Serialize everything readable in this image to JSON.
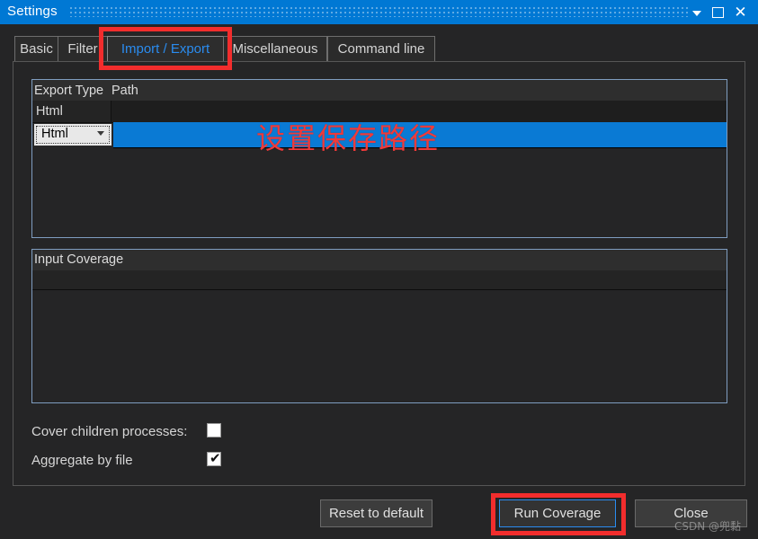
{
  "window": {
    "title": "Settings",
    "controls": {
      "minimize_icon": "chevron-down-icon",
      "maximize_icon": "maximize-square-icon",
      "close_icon": "close-x-icon",
      "close_glyph": "✕"
    },
    "accent_color": "#0078d4"
  },
  "tabs": [
    {
      "label": "Basic",
      "selected": false
    },
    {
      "label": "Filter",
      "selected": false
    },
    {
      "label": "Import / Export",
      "selected": true
    },
    {
      "label": "Miscellaneous",
      "selected": false
    },
    {
      "label": "Command line",
      "selected": false
    }
  ],
  "export_table": {
    "columns": [
      "Export Type",
      "Path"
    ],
    "rows": [
      {
        "type": "Html",
        "path": ""
      }
    ],
    "editor": {
      "combo_value": "Html",
      "combo_arrow_icon": "chevron-down-icon",
      "path_value": "",
      "selected": true,
      "selection_color": "#0a7ad4"
    }
  },
  "input_coverage": {
    "title": "Input Coverage",
    "rows": []
  },
  "options": [
    {
      "label": "Cover children processes:",
      "checked": false,
      "check_glyph": ""
    },
    {
      "label": "Aggregate by file",
      "checked": true,
      "check_glyph": "✔"
    }
  ],
  "buttons": {
    "reset": "Reset to default",
    "run": "Run Coverage",
    "close": "Close"
  },
  "annotations": {
    "chinese_note": "设置保存路径",
    "box_color": "#f22d2d",
    "boxes": [
      "tab-import-export",
      "run-coverage-button"
    ]
  },
  "watermark": "CSDN @兜黏"
}
